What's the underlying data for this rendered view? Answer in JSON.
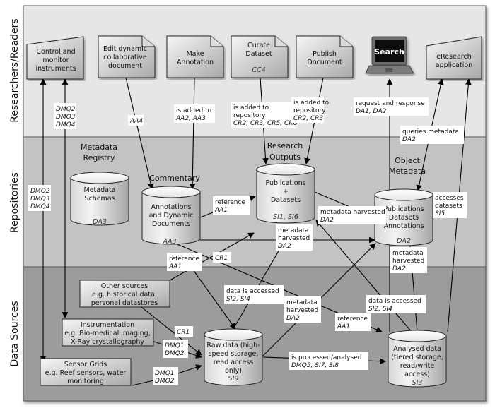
{
  "lanes": [
    {
      "id": "researchers",
      "title": "Researchers/Readers",
      "color": "#e6e6e6"
    },
    {
      "id": "repositories",
      "title": "Repositories",
      "color": "#c2c2c2"
    },
    {
      "id": "data_sources",
      "title": "Data Sources",
      "color": "#9c9c9c"
    }
  ],
  "groups": {
    "metadata_registry": [
      "Metadata",
      "Registry"
    ],
    "commentary": [
      "Commentary"
    ],
    "research_outputs": [
      "Research",
      "Outputs"
    ],
    "object_metadata": [
      "Object",
      "Metadata"
    ]
  },
  "nodes": {
    "control_instruments": {
      "lines": [
        "Control and",
        "monitor",
        "instruments"
      ],
      "shape": "manual-input"
    },
    "edit_document": {
      "lines": [
        "Edit dynamic",
        "collaborative",
        "document"
      ],
      "shape": "document"
    },
    "make_annotation": {
      "lines": [
        "Make",
        "Annotation"
      ],
      "shape": "document"
    },
    "curate_dataset": {
      "lines": [
        "Curate",
        "Dataset"
      ],
      "code": "CC4",
      "shape": "document"
    },
    "publish_document": {
      "lines": [
        "Publish",
        "Document"
      ],
      "shape": "document"
    },
    "search": {
      "label": "Search",
      "shape": "laptop"
    },
    "eresearch_app": {
      "lines": [
        "eResearch",
        "application"
      ],
      "shape": "manual-input"
    },
    "metadata_schemas": {
      "lines": [
        "Metadata",
        "Schemas"
      ],
      "code": "DA3",
      "shape": "cylinder"
    },
    "annotations_docs": {
      "lines": [
        "Annotations",
        "and Dynamic",
        "Documents"
      ],
      "code": "AA3",
      "shape": "cylinder"
    },
    "publications_datasets": {
      "lines": [
        "Publications",
        "+",
        "Datasets"
      ],
      "code": "SI1, SI6",
      "shape": "cylinder"
    },
    "object_metadata_store": {
      "lines": [
        "Publications",
        "Datasets",
        "Annotations"
      ],
      "code": "DA2",
      "shape": "cylinder"
    },
    "other_sources": {
      "lines": [
        "Other sources",
        "e.g. historical data,",
        "personal datastores"
      ],
      "shape": "box"
    },
    "instrumentation": {
      "lines": [
        "Instrumentation",
        "e.g. Bio-medical imaging,",
        "X-Ray crystallography"
      ],
      "shape": "box"
    },
    "sensor_grids": {
      "lines": [
        "Sensor Grids",
        "e.g. Reef sensors, water",
        "monitoring"
      ],
      "shape": "box"
    },
    "raw_data": {
      "lines": [
        "Raw data (high-",
        "speed storage,",
        "read access",
        "only)"
      ],
      "code": "SI9",
      "shape": "cylinder"
    },
    "analysed_data": {
      "lines": [
        "Analysed data",
        "(tiered storage,",
        "read/write",
        "access)"
      ],
      "code": "SI3",
      "shape": "cylinder"
    }
  },
  "edge_labels": {
    "dmq_top": {
      "lines": [
        "DMQ2",
        "DMQ3",
        "DMQ4"
      ],
      "italic": [
        0,
        1,
        2
      ]
    },
    "dmq_left": {
      "lines": [
        "DMQ2",
        "DMQ3",
        "DMQ4"
      ],
      "italic": [
        0,
        1,
        2
      ]
    },
    "aa4": {
      "lines": [
        "AA4"
      ],
      "italic": [
        0
      ]
    },
    "annotation_added": {
      "lines": [
        "is added to",
        "AA2, AA3"
      ],
      "italic": [
        1
      ]
    },
    "curate_added": {
      "lines": [
        "is added to",
        "repository",
        "CR2, CR3, CR5, CR6"
      ],
      "italic": [
        2
      ]
    },
    "publish_added": {
      "lines": [
        "is added to",
        "repository",
        "CR2, CR3"
      ],
      "italic": [
        2
      ]
    },
    "search_req": {
      "lines": [
        "request and response",
        "DA1, DA2"
      ],
      "italic": [
        1
      ]
    },
    "queries_meta": {
      "lines": [
        "queries metadata",
        "DA2"
      ],
      "italic": [
        1
      ]
    },
    "ref_ann_pub": {
      "lines": [
        "reference",
        "AA1"
      ],
      "italic": [
        1
      ]
    },
    "meta_harv_pub_obj": {
      "lines": [
        "metadata harvested",
        "DA2"
      ],
      "italic": [
        1
      ]
    },
    "accesses_datasets": {
      "lines": [
        "accesses",
        "datasets",
        "SI5"
      ],
      "italic": [
        2
      ]
    },
    "meta_harv_ann_obj": {
      "lines": [
        "metadata",
        "harvested",
        "DA2"
      ],
      "italic": [
        2
      ]
    },
    "meta_harv_obj_below": {
      "lines": [
        "metadata",
        "harvested",
        "DA2"
      ],
      "italic": [
        2
      ]
    },
    "ref_aa1_low": {
      "lines": [
        "reference",
        "AA1"
      ],
      "italic": [
        1
      ]
    },
    "cr1_top": {
      "lines": [
        "CR1"
      ],
      "italic": [
        0
      ]
    },
    "cr1_bottom": {
      "lines": [
        "CR1"
      ],
      "italic": [
        0
      ]
    },
    "data_accessed_raw": {
      "lines": [
        "data is accessed",
        "SI2, SI4"
      ],
      "italic": [
        1
      ]
    },
    "meta_harv_raw": {
      "lines": [
        "metadata",
        "harvested",
        "DA2"
      ],
      "italic": [
        2
      ]
    },
    "ref_analysed": {
      "lines": [
        "reference",
        "AA1"
      ],
      "italic": [
        1
      ]
    },
    "data_accessed_analysed": {
      "lines": [
        "data is accessed",
        "SI2, SI4"
      ],
      "italic": [
        1
      ]
    },
    "dmq_instr": {
      "lines": [
        "DMQ1",
        "DMQ2"
      ],
      "italic": [
        0,
        1
      ]
    },
    "dmq_sensor": {
      "lines": [
        "DMQ1",
        "DMQ2"
      ],
      "italic": [
        0,
        1
      ]
    },
    "processed": {
      "lines": [
        "is processed/analysed",
        "DMQ5, SI7, SI8"
      ],
      "italic": [
        1
      ]
    }
  },
  "colors": {
    "node_fill_light": "#f4f4f4",
    "node_fill_dark": "#a8a8a8",
    "laptop_body": "#6d6d6d",
    "laptop_screen": "#111111"
  }
}
